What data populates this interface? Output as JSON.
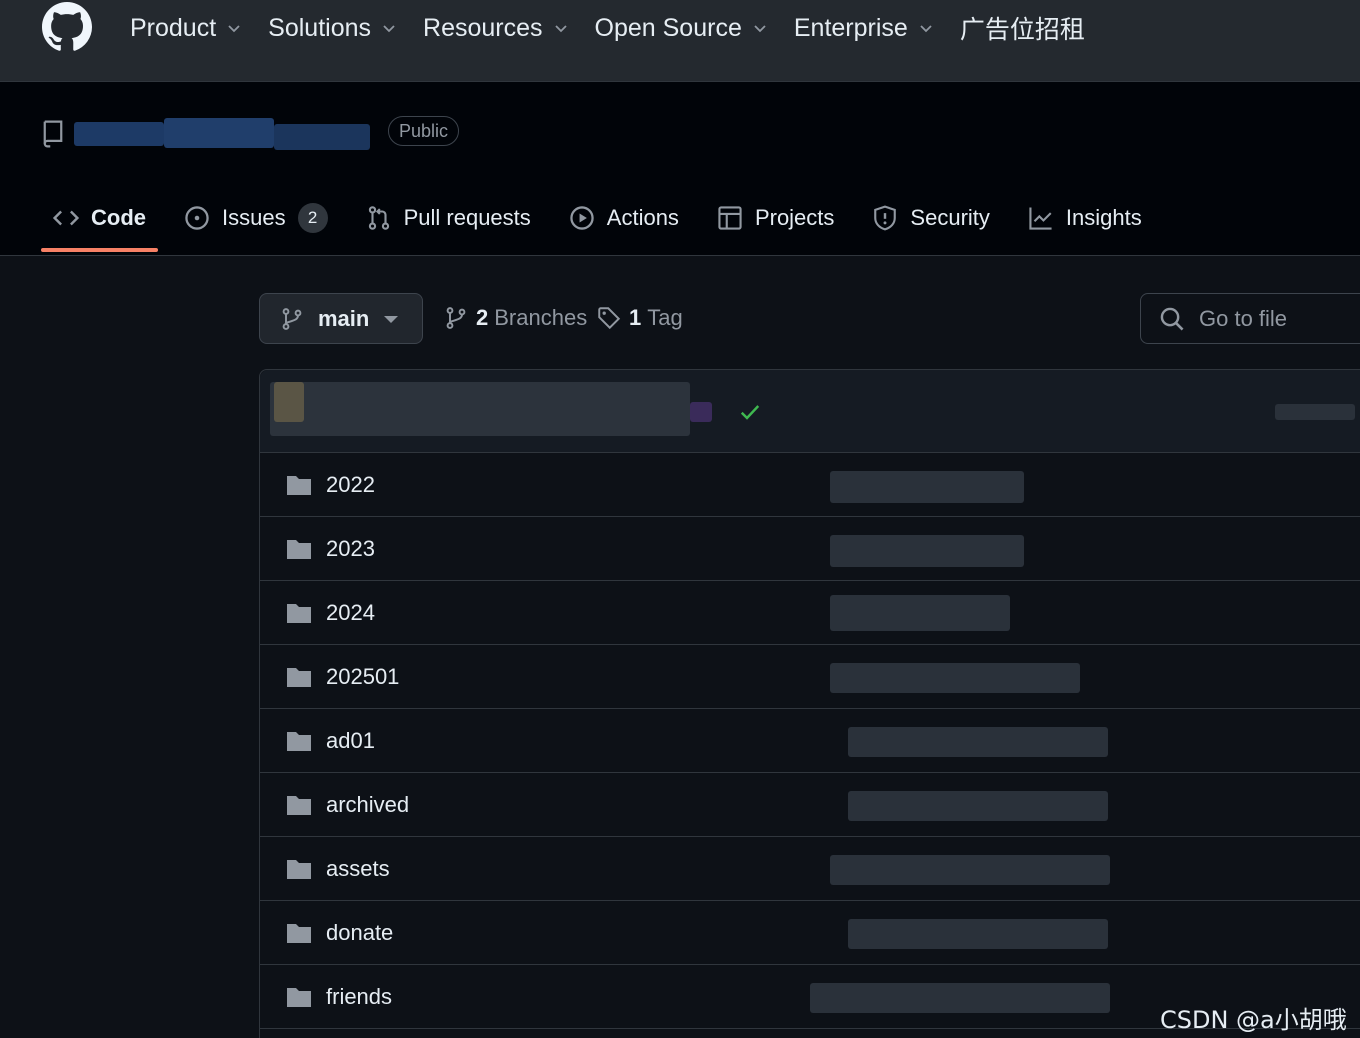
{
  "topnav": {
    "items": [
      {
        "label": "Product"
      },
      {
        "label": "Solutions"
      },
      {
        "label": "Resources"
      },
      {
        "label": "Open Source"
      },
      {
        "label": "Enterprise"
      }
    ],
    "ad_label": "广告位招租"
  },
  "repo": {
    "visibility": "Public"
  },
  "tabs": {
    "code": "Code",
    "issues": "Issues",
    "issues_count": "2",
    "pull_requests": "Pull requests",
    "actions": "Actions",
    "projects": "Projects",
    "security": "Security",
    "insights": "Insights"
  },
  "branch": {
    "current": "main",
    "branches_count": "2",
    "branches_label": "Branches",
    "tags_count": "1",
    "tags_label": "Tag"
  },
  "search": {
    "placeholder": "Go to file"
  },
  "files": [
    {
      "name": "2022"
    },
    {
      "name": "2023"
    },
    {
      "name": "2024"
    },
    {
      "name": "202501"
    },
    {
      "name": "ad01"
    },
    {
      "name": "archived"
    },
    {
      "name": "assets"
    },
    {
      "name": "donate"
    },
    {
      "name": "friends"
    }
  ],
  "watermark": "CSDN @a小胡哦",
  "colors": {
    "accent_underline": "#f78166",
    "link_blue": "#4493f8",
    "check_green": "#3fb950"
  }
}
